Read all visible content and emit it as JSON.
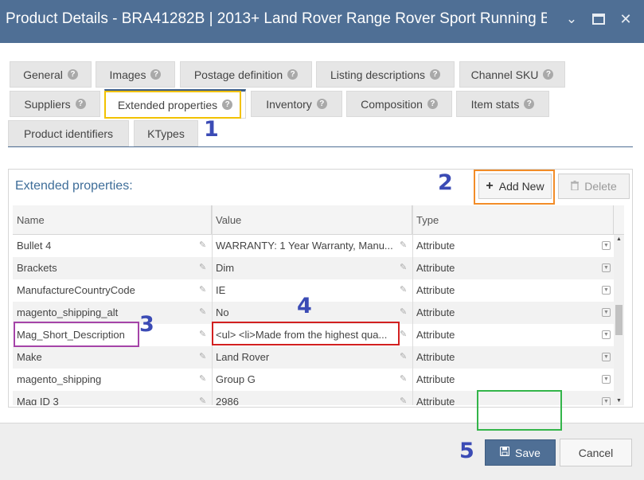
{
  "window": {
    "title": "Product Details - BRA41282B | 2013+ Land Rover Range Rover Sport Running B...",
    "minimize_icon": "chevron-down-icon",
    "maximize_icon": "maximize-icon",
    "close_icon": "close-icon"
  },
  "tabs": [
    {
      "label": "General",
      "active": false
    },
    {
      "label": "Images",
      "active": false
    },
    {
      "label": "Postage definition",
      "active": false
    },
    {
      "label": "Listing descriptions",
      "active": false
    },
    {
      "label": "Channel SKU",
      "active": false
    },
    {
      "label": "Suppliers",
      "active": false
    },
    {
      "label": "Extended properties",
      "active": true
    },
    {
      "label": "Inventory",
      "active": false
    },
    {
      "label": "Composition",
      "active": false
    },
    {
      "label": "Item stats",
      "active": false
    },
    {
      "label": "Product identifiers",
      "active": false
    },
    {
      "label": "KTypes",
      "active": false
    }
  ],
  "help_glyph": "?",
  "annotations": {
    "n1": "1",
    "n2": "2",
    "n3": "3",
    "n4": "4",
    "n5": "5"
  },
  "panel": {
    "title": "Extended properties:",
    "add_label": "Add New",
    "delete_label": "Delete"
  },
  "grid": {
    "columns": [
      "Name",
      "Value",
      "Type"
    ],
    "rows": [
      {
        "name": "Bullet 4",
        "value": "WARRANTY: 1 Year Warranty, Manu...",
        "type": "Attribute"
      },
      {
        "name": "Brackets",
        "value": "Dim",
        "type": "Attribute"
      },
      {
        "name": "ManufactureCountryCode",
        "value": "IE",
        "type": "Attribute"
      },
      {
        "name": "magento_shipping_alt",
        "value": "No",
        "type": "Attribute"
      },
      {
        "name": "Mag_Short_Description",
        "value": "<ul> <li>Made from the highest qua...",
        "type": "Attribute"
      },
      {
        "name": "Make",
        "value": "Land Rover",
        "type": "Attribute"
      },
      {
        "name": "magento_shipping",
        "value": "Group G",
        "type": "Attribute"
      },
      {
        "name": "Mag ID 3",
        "value": "2986",
        "type": "Attribute"
      }
    ]
  },
  "footer": {
    "save_label": "Save",
    "cancel_label": "Cancel"
  },
  "colors": {
    "titlebar": "#4f6f95",
    "highlight_tab": "#f2c200",
    "highlight_add": "#f28c28",
    "highlight_name": "#a544a8",
    "highlight_value": "#d22020",
    "highlight_save": "#33b54a",
    "annotation_number": "#3b4bb5"
  }
}
